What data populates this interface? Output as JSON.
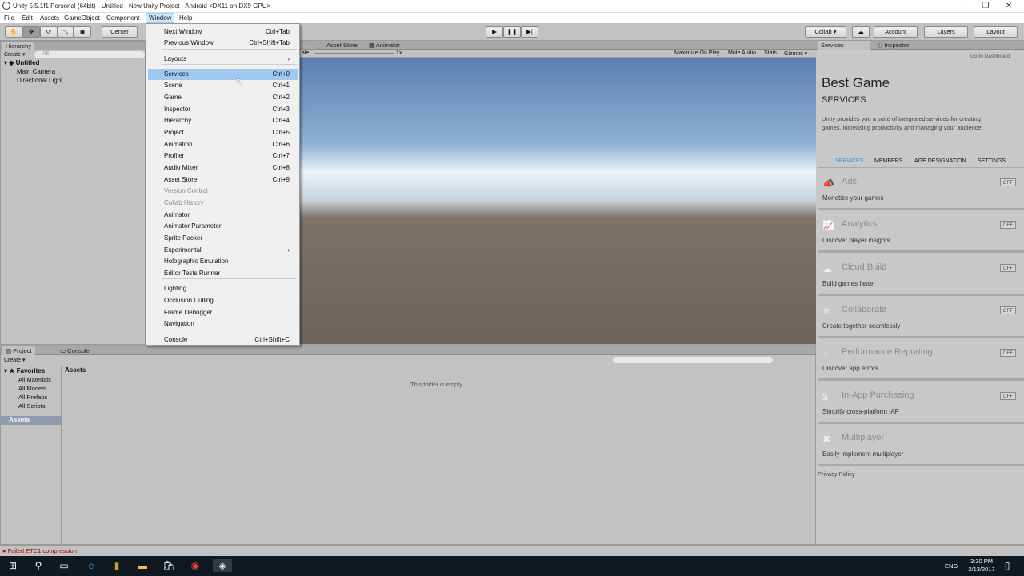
{
  "window": {
    "title": "Unity 5.5.1f1 Personal (64bit) - Untitled - New Unity Project - Android <DX11 on DX9 GPU>"
  },
  "menubar": [
    "File",
    "Edit",
    "Assets",
    "GameObject",
    "Component",
    "Window",
    "Help"
  ],
  "toolbar": {
    "center": "Center",
    "collab": "Collab ▾",
    "account": "Account",
    "layers": "Layers",
    "layout": "Layout"
  },
  "hierarchy": {
    "tab": "Hierarchy",
    "create": "Create ▾",
    "search": "All",
    "scene": "Untitled",
    "items": [
      "Main Camera",
      "Directional Light"
    ]
  },
  "scene_tabs": {
    "asset_store": "Asset Store",
    "animator": "Animator",
    "scale": "ale",
    "scale_val": "1x",
    "maximize": "Maximize On Play",
    "mute": "Mute Audio",
    "stats": "Stats",
    "gizmos": "Gizmos ▾"
  },
  "window_menu": {
    "items": [
      {
        "label": "Next Window",
        "shortcut": "Ctrl+Tab"
      },
      {
        "label": "Previous Window",
        "shortcut": "Ctrl+Shift+Tab"
      },
      {
        "label": "Layouts",
        "shortcut": "›"
      },
      {
        "label": "Services",
        "shortcut": "Ctrl+0"
      },
      {
        "label": "Scene",
        "shortcut": "Ctrl+1"
      },
      {
        "label": "Game",
        "shortcut": "Ctrl+2"
      },
      {
        "label": "Inspector",
        "shortcut": "Ctrl+3"
      },
      {
        "label": "Hierarchy",
        "shortcut": "Ctrl+4"
      },
      {
        "label": "Project",
        "shortcut": "Ctrl+5"
      },
      {
        "label": "Animation",
        "shortcut": "Ctrl+6"
      },
      {
        "label": "Profiler",
        "shortcut": "Ctrl+7"
      },
      {
        "label": "Audio Mixer",
        "shortcut": "Ctrl+8"
      },
      {
        "label": "Asset Store",
        "shortcut": "Ctrl+9"
      },
      {
        "label": "Version Control",
        "shortcut": ""
      },
      {
        "label": "Collab History",
        "shortcut": ""
      },
      {
        "label": "Animator",
        "shortcut": ""
      },
      {
        "label": "Animator Parameter",
        "shortcut": ""
      },
      {
        "label": "Sprite Packer",
        "shortcut": ""
      },
      {
        "label": "Experimental",
        "shortcut": "›"
      },
      {
        "label": "Holographic Emulation",
        "shortcut": ""
      },
      {
        "label": "Editor Tests Runner",
        "shortcut": ""
      },
      {
        "label": "Lighting",
        "shortcut": ""
      },
      {
        "label": "Occlusion Culling",
        "shortcut": ""
      },
      {
        "label": "Frame Debugger",
        "shortcut": ""
      },
      {
        "label": "Navigation",
        "shortcut": ""
      },
      {
        "label": "Console",
        "shortcut": "Ctrl+Shift+C"
      }
    ]
  },
  "services": {
    "tab": "Services",
    "inspector_tab": "Inspector",
    "dashboard": "Go to Dashboard",
    "project_name": "Best Game",
    "heading": "SERVICES",
    "intro": "Unity provides you a suite of integrated services for creating games, increasing productivity and managing your audience.",
    "nav": [
      "SERVICES",
      "MEMBERS",
      "AGE DESIGNATION",
      "SETTINGS"
    ],
    "list": [
      {
        "name": "Ads",
        "desc": "Monetize your games",
        "state": "OFF",
        "icon": "📣"
      },
      {
        "name": "Analytics",
        "desc": "Discover player insights",
        "state": "OFF",
        "icon": "📈"
      },
      {
        "name": "Cloud Build",
        "desc": "Build games faster",
        "state": "OFF",
        "icon": "☁"
      },
      {
        "name": "Collaborate",
        "desc": "Create together seamlessly",
        "state": "OFF",
        "icon": "✳"
      },
      {
        "name": "Performance Reporting",
        "desc": "Discover app errors",
        "state": "OFF",
        "icon": "◔"
      },
      {
        "name": "In-App Purchasing",
        "desc": "Simplify cross-platform IAP",
        "state": "OFF",
        "icon": "$"
      },
      {
        "name": "Multiplayer",
        "desc": "Easily implement multiplayer",
        "state": "",
        "icon": "✖"
      }
    ],
    "privacy": "Privacy Policy"
  },
  "project": {
    "tab": "Project",
    "console_tab": "Console",
    "create": "Create ▾",
    "favorites": "Favorites",
    "fav_items": [
      "All Materials",
      "All Models",
      "All Prefabs",
      "All Scripts"
    ],
    "assets": "Assets",
    "header": "Assets",
    "empty": "This folder is empty"
  },
  "status": {
    "error": "Failed ETC1 compression"
  },
  "tray": {
    "lang": "ENG",
    "time": "3:30 PM",
    "date": "2/13/2017"
  }
}
